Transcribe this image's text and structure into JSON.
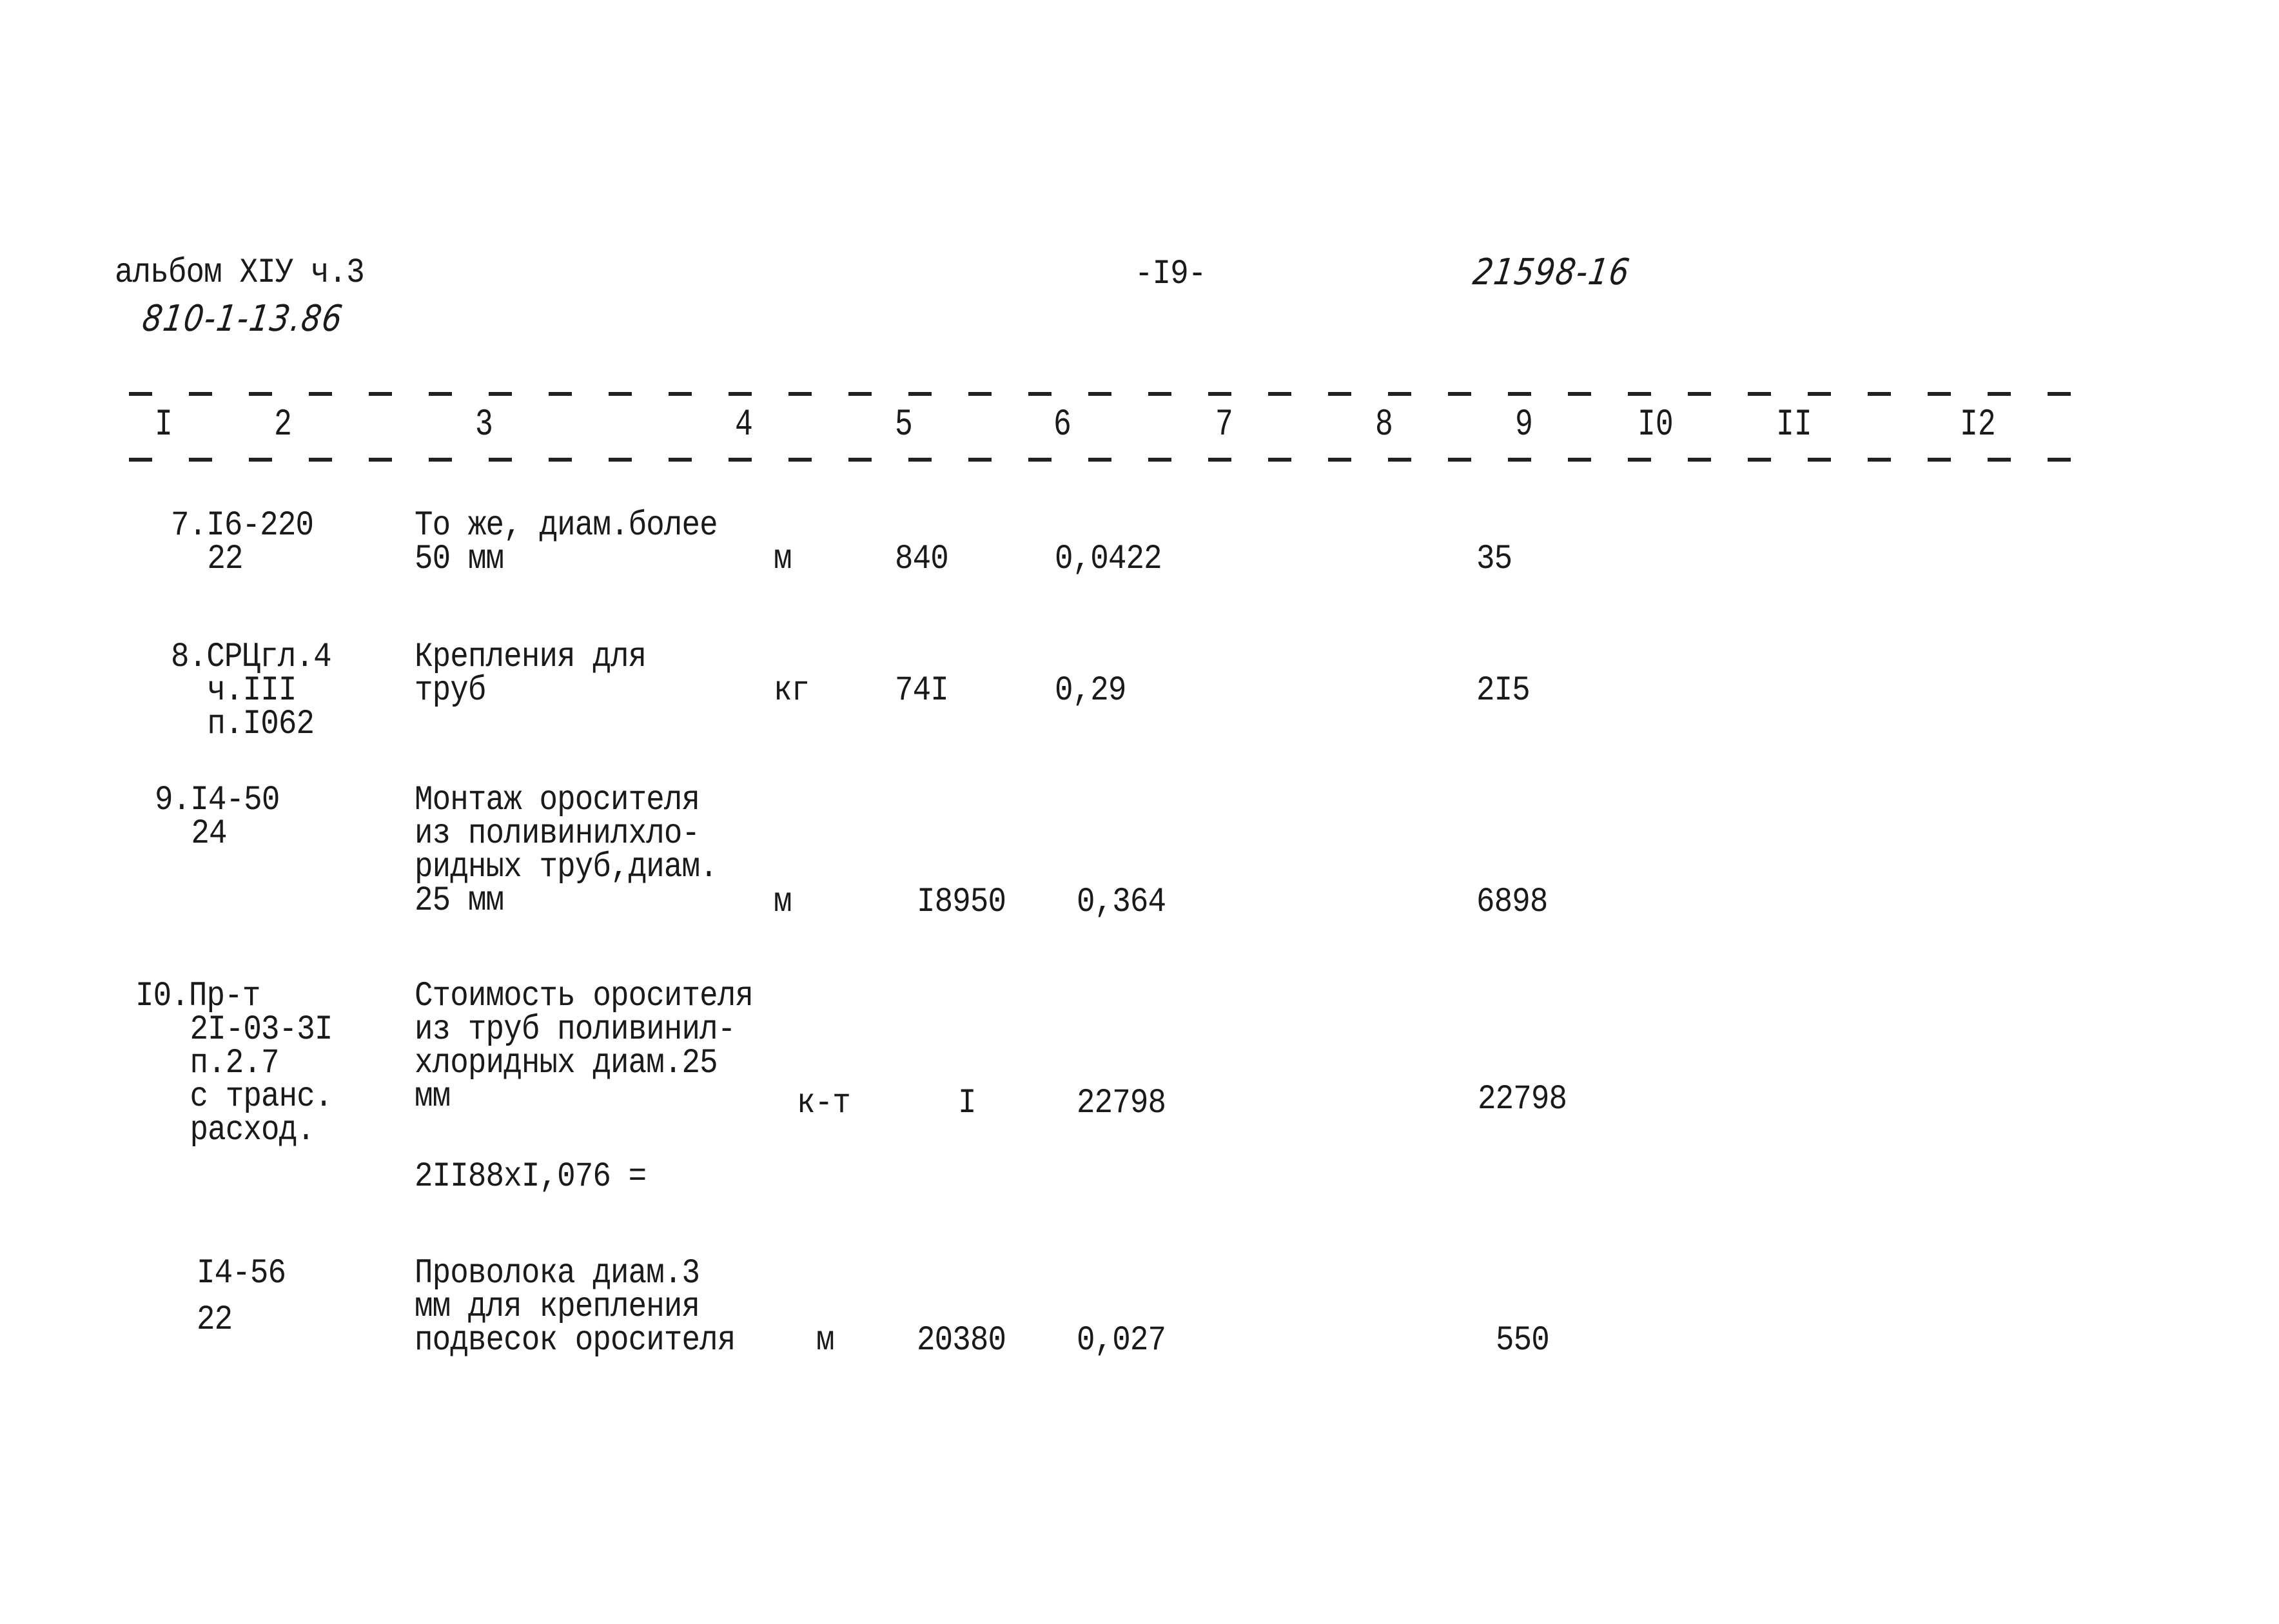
{
  "header": {
    "album": "альбом XIУ ч.3",
    "project_code": "810-1-13.86",
    "page_number": "-I9-",
    "document_code": "21598-16"
  },
  "table": {
    "column_numbers": [
      "I",
      "2",
      "3",
      "4",
      "5",
      "6",
      "7",
      "8",
      "9",
      "I0",
      "II",
      "I2"
    ],
    "rows": [
      {
        "ref_lines": [
          "7.I6-220",
          "22"
        ],
        "desc_lines": [
          "То же, диам.более",
          "50  мм"
        ],
        "unit": "м",
        "quantity": "840",
        "unit_value": "0,0422",
        "total": "35"
      },
      {
        "ref_lines": [
          "8.СРЦгл.4",
          "ч.III",
          "п.I062"
        ],
        "desc_lines": [
          "Крепления для",
          "труб"
        ],
        "unit": "кг",
        "quantity": "74I",
        "unit_value": "0,29",
        "total": "2I5"
      },
      {
        "ref_lines": [
          "9.I4-50",
          "24"
        ],
        "desc_lines": [
          "Монтаж оросителя",
          "из поливинилхло-",
          "ридных труб,диам.",
          "25  мм"
        ],
        "unit": "м",
        "quantity": "I8950",
        "unit_value": "0,364",
        "total": "6898"
      },
      {
        "ref_lines": [
          "I0.Пр-т",
          "2I-03-3I",
          "п.2.7",
          "с транс.",
          "расход."
        ],
        "desc_lines": [
          "Стоимость оросителя",
          "из труб поливинил-",
          "хлоридных диам.25",
          "мм"
        ],
        "unit": "к-т",
        "quantity": "I",
        "unit_value": "22798",
        "total": "22798",
        "formula": "2II88xI,076 ="
      },
      {
        "ref_lines": [
          "I4-56",
          "22"
        ],
        "desc_lines": [
          "Проволока диам.3",
          "мм для крепления",
          "подвесок оросителя"
        ],
        "unit": "м",
        "quantity": "20380",
        "unit_value": "0,027",
        "total": "550"
      }
    ]
  }
}
